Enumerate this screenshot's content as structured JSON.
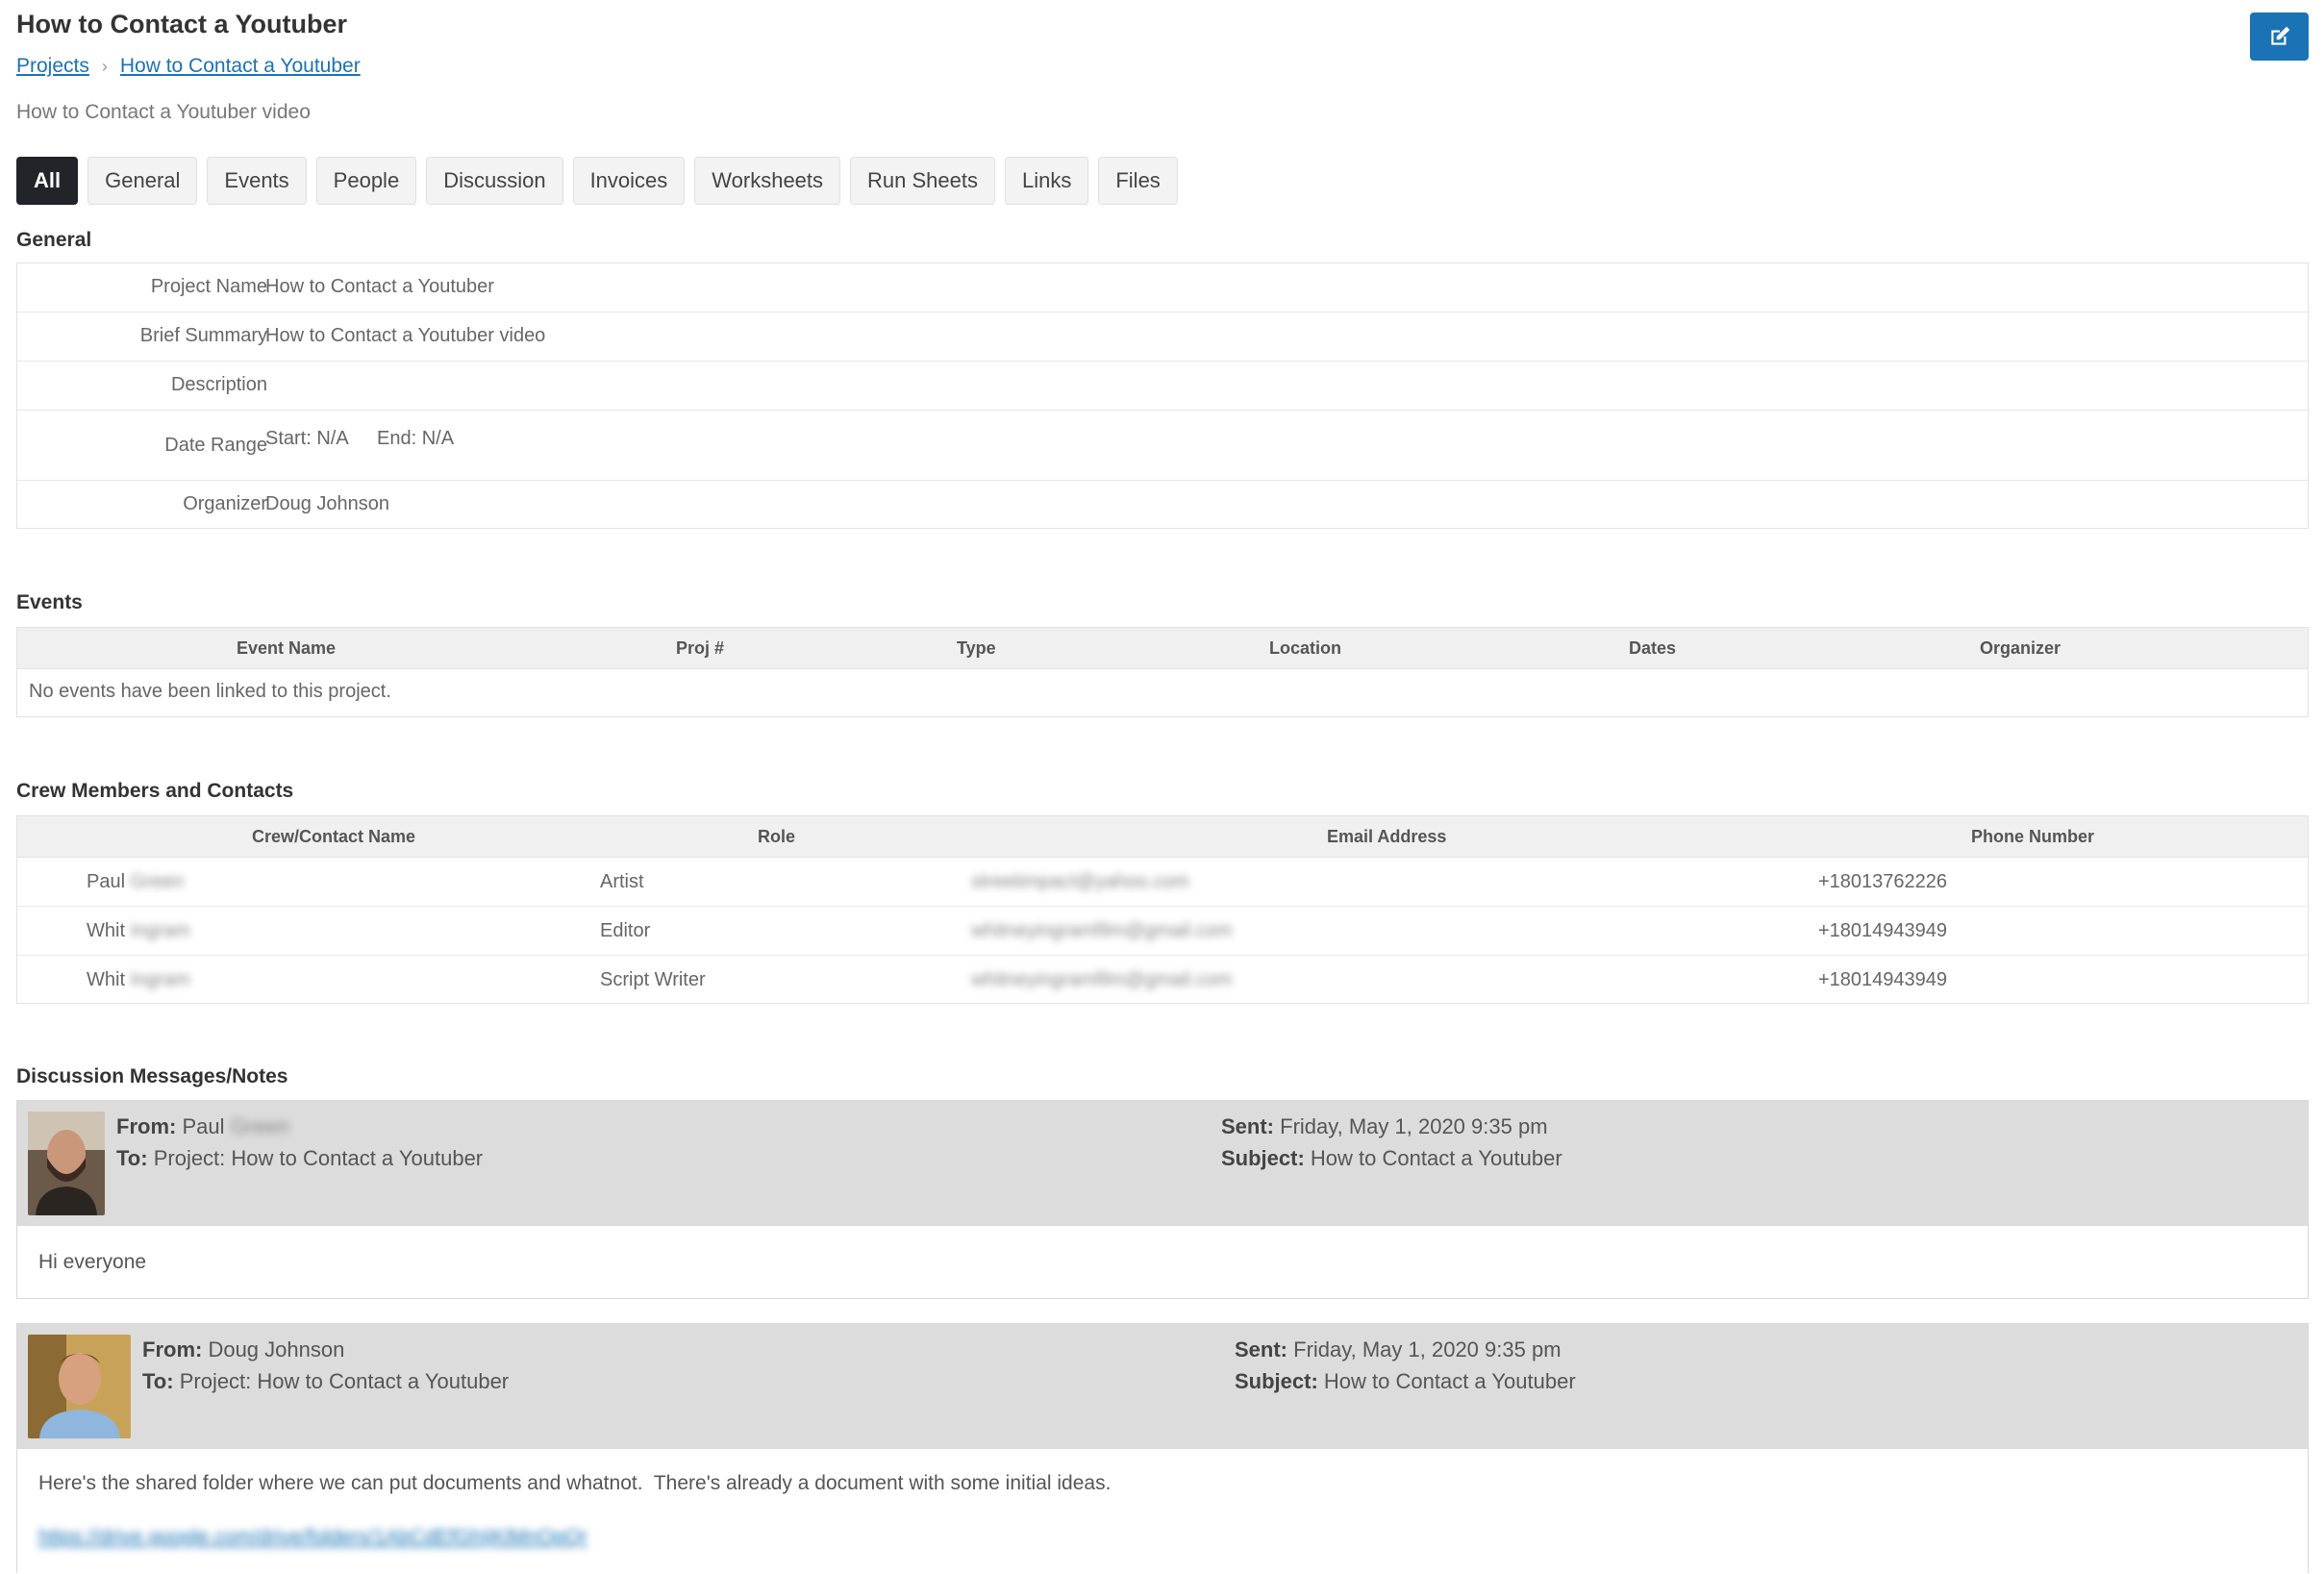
{
  "page": {
    "title": "How to Contact a Youtuber",
    "breadcrumb": {
      "root": "Projects",
      "current": "How to Contact a Youtuber"
    },
    "summary": "How to Contact a Youtuber video"
  },
  "tabs": [
    {
      "label": "All",
      "active": true
    },
    {
      "label": "General"
    },
    {
      "label": "Events"
    },
    {
      "label": "People"
    },
    {
      "label": "Discussion"
    },
    {
      "label": "Invoices"
    },
    {
      "label": "Worksheets"
    },
    {
      "label": "Run Sheets"
    },
    {
      "label": "Links"
    },
    {
      "label": "Files"
    }
  ],
  "general": {
    "heading": "General",
    "project_name_label": "Project Name",
    "project_name": "How to Contact a Youtuber",
    "brief_summary_label": "Brief Summary",
    "brief_summary": "How to Contact a Youtuber video",
    "description_label": "Description",
    "date_range_label": "Date Range",
    "start": "Start: N/A",
    "end": "End: N/A",
    "organizer_label": "Organizer",
    "organizer": "Doug Johnson"
  },
  "events": {
    "heading": "Events",
    "columns": [
      "Event Name",
      "Proj #",
      "Type",
      "Location",
      "Dates",
      "Organizer"
    ],
    "empty_text": "No events have been linked to this project."
  },
  "crew": {
    "heading": "Crew Members and Contacts",
    "columns": [
      "Crew/Contact Name",
      "Role",
      "Email Address",
      "Phone Number"
    ],
    "rows": [
      {
        "first": "Paul",
        "last": "Green",
        "role": "Artist",
        "email": "streetimpact@yahoo.com",
        "phone": "+18013762226"
      },
      {
        "first": "Whit",
        "last": "Ingram",
        "role": "Editor",
        "email": "whitneyingramfilm@gmail.com",
        "phone": "+18014943949"
      },
      {
        "first": "Whit",
        "last": "Ingram",
        "role": "Script Writer",
        "email": "whitneyingramfilm@gmail.com",
        "phone": "+18014943949"
      }
    ]
  },
  "discussion": {
    "heading": "Discussion Messages/Notes",
    "from_label": "From:",
    "to_label": "To:",
    "sent_label": "Sent:",
    "subject_label": "Subject:",
    "messages": [
      {
        "from_first": "Paul",
        "from_last": "Green",
        "to": "Project: How to Contact a Youtuber",
        "sent": "Friday, May 1, 2020 9:35 pm",
        "subject": "How to Contact a Youtuber",
        "body": "Hi everyone"
      },
      {
        "from_first": "Doug Johnson",
        "to": "Project: How to Contact a Youtuber",
        "sent": "Friday, May 1, 2020 9:35 pm",
        "subject": "How to Contact a Youtuber",
        "body": "Here's the shared folder where we can put documents and whatnot.  There's already a document with some initial ideas.",
        "link": "https://drive.google.com/drive/folders/1AbCdEfGhIjKlMnOpQr"
      }
    ]
  },
  "colors": {
    "accent": "#1a73b5",
    "tab_active": "#212529",
    "message_header": "#dcdcdc"
  }
}
